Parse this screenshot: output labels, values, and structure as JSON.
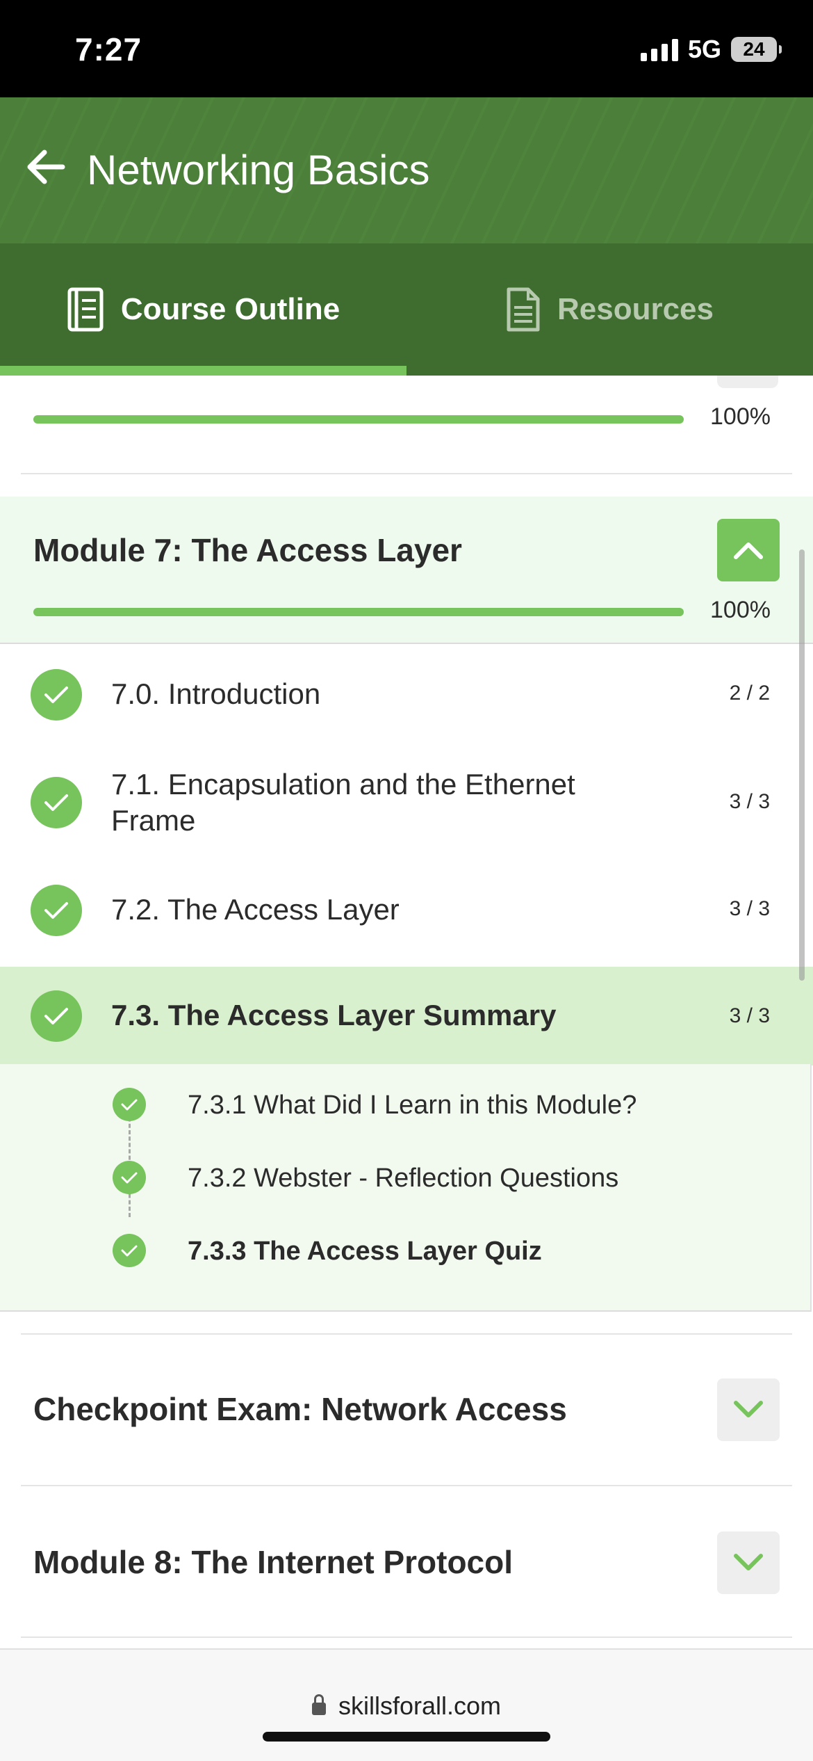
{
  "status_bar": {
    "time": "7:27",
    "network": "5G",
    "battery": "24"
  },
  "header": {
    "title": "Networking Basics"
  },
  "tabs": [
    {
      "label": "Course Outline",
      "icon": "book-icon",
      "active": true
    },
    {
      "label": "Resources",
      "icon": "document-icon",
      "active": false
    }
  ],
  "previous_module": {
    "progress_text": "100%",
    "progress": 1.0
  },
  "current_module": {
    "title": "Module 7: The Access Layer",
    "progress_text": "100%",
    "progress": 1.0,
    "expanded": true,
    "lessons": [
      {
        "label": "7.0. Introduction",
        "count": "2 / 2"
      },
      {
        "label": "7.1. Encapsulation and the Ethernet Frame",
        "count": "3 / 3"
      },
      {
        "label": "7.2. The Access Layer",
        "count": "3 / 3"
      },
      {
        "label": "7.3. The Access Layer Summary",
        "count": "3 / 3",
        "current": true
      }
    ],
    "sub_items": [
      {
        "label": "7.3.1 What Did I Learn in this Module?"
      },
      {
        "label": "7.3.2 Webster - Reflection Questions"
      },
      {
        "label": "7.3.3 The Access Layer Quiz",
        "current": true
      }
    ]
  },
  "collapsed_modules": [
    {
      "title": "Checkpoint Exam: Network Access"
    },
    {
      "title": "Module 8: The Internet Protocol"
    }
  ],
  "browser": {
    "url": "skillsforall.com"
  },
  "colors": {
    "header_green": "#4b7f3a",
    "tab_bar_green": "#3f6d2f",
    "accent_green": "#77c35c",
    "highlight_row": "#d8f0cd"
  }
}
